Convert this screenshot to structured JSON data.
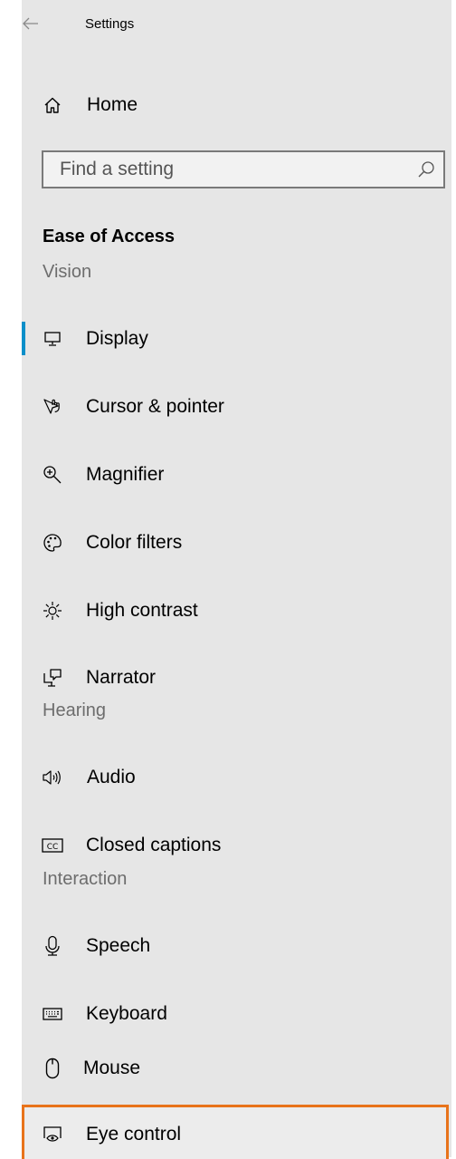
{
  "window": {
    "title": "Settings"
  },
  "home": {
    "label": "Home"
  },
  "search": {
    "placeholder": "Find a setting"
  },
  "section": {
    "title": "Ease of Access"
  },
  "groups": {
    "vision": "Vision",
    "hearing": "Hearing",
    "interaction": "Interaction"
  },
  "nav": {
    "display": "Display",
    "cursor": "Cursor & pointer",
    "magnifier": "Magnifier",
    "color_filters": "Color filters",
    "high_contrast": "High contrast",
    "narrator": "Narrator",
    "audio": "Audio",
    "closed_captions": "Closed captions",
    "speech": "Speech",
    "keyboard": "Keyboard",
    "mouse": "Mouse",
    "eye_control": "Eye control"
  },
  "state": {
    "selected": "Display",
    "highlighted": "Eye control"
  },
  "colors": {
    "accent": "#0a8fc9",
    "highlight_border": "#e8731a",
    "panel": "#e6e6e6"
  },
  "icons": {
    "back": "back-arrow-icon",
    "home": "home-icon",
    "search": "search-icon",
    "display": "monitor-icon",
    "cursor": "pointer-hand-icon",
    "magnifier": "zoom-in-icon",
    "color_filters": "palette-icon",
    "high_contrast": "sun-icon",
    "narrator": "narrator-icon",
    "audio": "speaker-icon",
    "closed_captions": "cc-icon",
    "speech": "microphone-icon",
    "keyboard": "keyboard-icon",
    "mouse": "mouse-icon",
    "eye_control": "eye-control-icon"
  }
}
